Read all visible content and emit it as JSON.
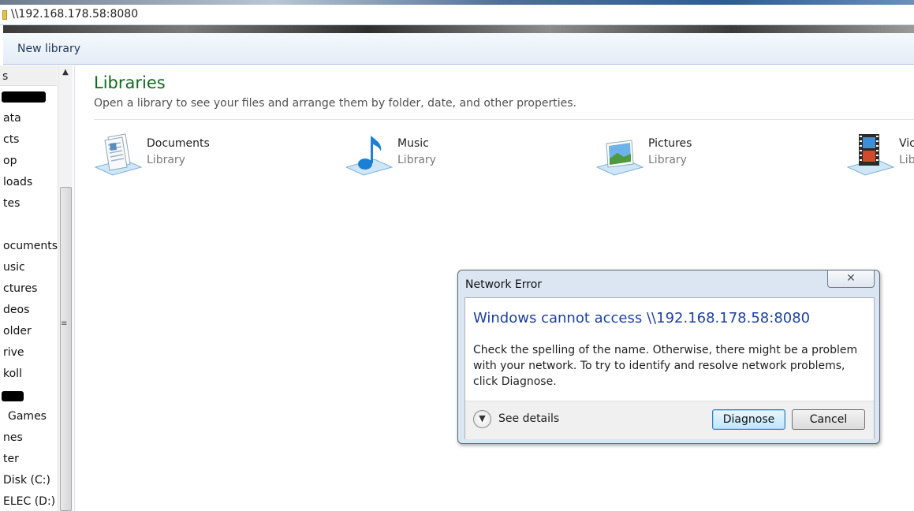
{
  "address_bar": {
    "path": "\\\\192.168.178.58:8080",
    "icon": "folder-icon"
  },
  "toolbar": {
    "new_library_label": "New library"
  },
  "nav": {
    "header": "s",
    "items": [
      "ata",
      "cts",
      "op",
      "loads",
      "tes",
      "ocuments",
      "usic",
      "ctures",
      "deos",
      "older",
      "rive",
      "koll",
      "Games",
      "nes",
      "ter",
      "Disk (C:)",
      "ELEC (D:)"
    ]
  },
  "libraries": {
    "title": "Libraries",
    "subtitle": "Open a library to see your files and arrange them by folder, date, and other properties.",
    "items": [
      {
        "name": "Documents",
        "kind": "Library",
        "icon": "documents-library-icon"
      },
      {
        "name": "Music",
        "kind": "Library",
        "icon": "music-library-icon"
      },
      {
        "name": "Pictures",
        "kind": "Library",
        "icon": "pictures-library-icon"
      },
      {
        "name": "Vic",
        "kind": "Lib",
        "icon": "videos-library-icon"
      }
    ]
  },
  "dialog": {
    "title": "Network Error",
    "close_label": "✕",
    "heading": "Windows cannot access \\\\192.168.178.58:8080",
    "message": "Check the spelling of the name. Otherwise, there might be a problem with your network. To try to identify and resolve network problems, click Diagnose.",
    "details_label": "See details",
    "diagnose_label": "Diagnose",
    "cancel_label": "Cancel"
  }
}
